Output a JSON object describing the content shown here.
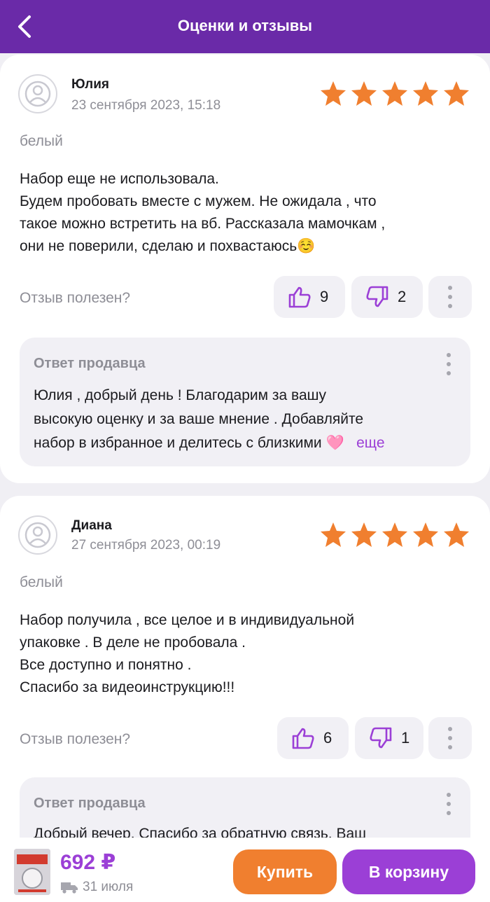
{
  "header": {
    "title": "Оценки и отзывы"
  },
  "reviews": [
    {
      "author": "Юлия",
      "date": "23 сентября 2023, 15:18",
      "rating": 5,
      "variant": "белый",
      "text_lines": [
        "Набор еще не использовала.",
        "Будем пробовать вместе с мужем. Не ожидала , что",
        "такое можно встретить на вб. Рассказала мамочкам ,",
        "они не поверили, сделаю и похвастаюсь☺️"
      ],
      "helpful_label": "Отзыв полезен?",
      "likes": "9",
      "dislikes": "2",
      "reply": {
        "title": "Ответ продавца",
        "lines": [
          "Юлия , добрый день ! Благодарим за вашу",
          "высокую оценку и за ваше мнение . Добавляйте",
          "набор в избранное и делитесь с близкими 🩷"
        ],
        "more": "еще"
      }
    },
    {
      "author": "Диана",
      "date": "27 сентября 2023, 00:19",
      "rating": 5,
      "variant": "белый",
      "text_lines": [
        "Набор получила , все целое и в индивидуальной",
        "упаковке . В деле не пробовала .",
        "Все доступно и понятно .",
        "Спасибо за видеоинструкцию!!!"
      ],
      "helpful_label": "Отзыв полезен?",
      "likes": "6",
      "dislikes": "1",
      "reply": {
        "title": "Ответ продавца",
        "lines": [
          "Добрый вечер. Спасибо за обратную связь. Ваш"
        ]
      }
    }
  ],
  "bottom_bar": {
    "price": "692 ₽",
    "delivery_date": "31 июля",
    "buy_label": "Купить",
    "cart_label": "В корзину"
  },
  "colors": {
    "header": "#6a2aa8",
    "accent": "#9b3fd6",
    "star": "#f07f2f",
    "buy": "#f07f2f"
  }
}
